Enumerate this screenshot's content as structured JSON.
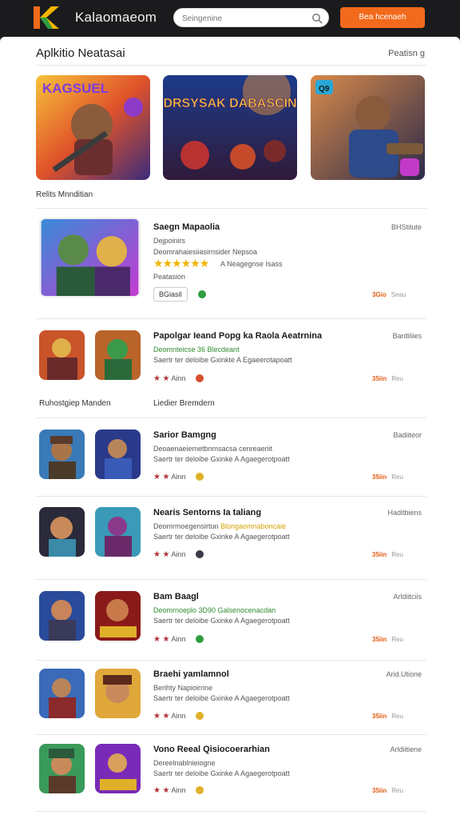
{
  "header": {
    "brand": "Kalaomaeom",
    "search_placeholder": "Seingenine",
    "cta_label": "Bea hcenaeh"
  },
  "featured": {
    "title": "Aplkitio Neatasai",
    "link": "Peatisn g",
    "banner_texts": [
      "KAGSUEL",
      "DRSYSAK DABASCIN",
      "Q9"
    ],
    "caption": "Relits Mnnditian"
  },
  "colors": {
    "accent": "#f26a1b",
    "page": "#ffffff",
    "topbar": "#1b1b1d"
  },
  "top_item": {
    "title": "Saegn Mapaolia",
    "line1": "Dejpoinirs",
    "line2": "Deomrahaiesiiasirnsider Nepsoa",
    "rating_text": "A Neagegnse Isass",
    "line3": "Peatasion",
    "button": "BGiasil",
    "price": "3Gio",
    "price_old": "Seau",
    "meta": "BHStitute"
  },
  "group_labels": [
    "Ruhostgiep Manden",
    "Liedier Bremdern"
  ],
  "items": [
    {
      "title": "Papolgar Ieand Popg ka Raola Aeatrnina",
      "line1": "Deomnteicse 36 Blecdeant",
      "line2": "Saertr ter deloibe Gxinkte A Egaeerotapoatt",
      "rate": "Ainn",
      "price": "35iin",
      "price_old": "Reu",
      "meta": "Bardiliies"
    },
    {
      "title": "Sarior Bamgng",
      "line1": "Deoaenaeiemetbnmsacsa cenreaeriit",
      "line2": "Saertr ter deloibe Gxinke A Agaegerotpoatt",
      "rate": "Ainn",
      "price": "35iin",
      "price_old": "Reu",
      "meta": "Badiiteor"
    },
    {
      "title": "Nearis Sentorns Ia taliang",
      "line1": "Deomrmoegensirtun",
      "line1b": "Blongaomnaboncaie",
      "line2": "Saertr ter deloibe Gxinke A Agaegerotpoatt",
      "rate": "Ainn",
      "price": "35iin",
      "price_old": "Reu",
      "meta": "Haditbiens"
    },
    {
      "title": "Bam Baagl",
      "line1": "Deomrnoeplo 3D90 Galsenocenacdan",
      "line2": "Saertr ter deloibe Gxinke A Agaegerotpoatt",
      "rate": "Ainn",
      "price": "35iin",
      "price_old": "Reu",
      "meta": "Arldiitciis"
    },
    {
      "title": "Braehi yamlamnol",
      "line1": "Berihty Napioirrine",
      "line2": "Saertr ter deloibe Gxinke A Agaegerotpoatt",
      "rate": "Ainn",
      "price": "35iin",
      "price_old": "Reu",
      "meta": "Arid.Utione"
    },
    {
      "title": "Vono Reeal Qisiocoerarhian",
      "line1": "Dereelnablnieiogne",
      "line2": "Saertr ter deloibe Gxinke A Agaegerotpoatt",
      "rate": "Ainn",
      "price": "35iin",
      "price_old": "Reu",
      "meta": "Arldiitiene"
    }
  ]
}
